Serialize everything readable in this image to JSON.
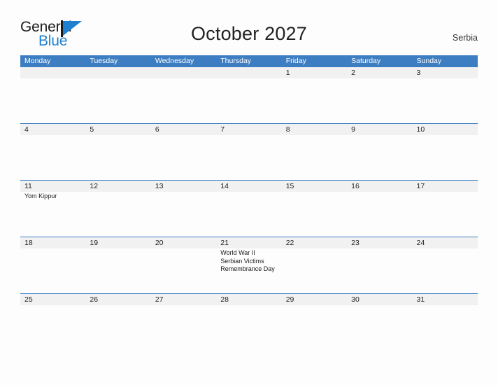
{
  "brand": {
    "name_part1": "General",
    "name_part2": "Blue",
    "flag_icon": "flag-triangle-icon"
  },
  "header": {
    "title": "October 2027",
    "region": "Serbia"
  },
  "calendar": {
    "month": "October",
    "year": "2027",
    "weekday_headers": [
      "Monday",
      "Tuesday",
      "Wednesday",
      "Thursday",
      "Friday",
      "Saturday",
      "Sunday"
    ],
    "weeks": [
      {
        "days": [
          {
            "num": "",
            "events": []
          },
          {
            "num": "",
            "events": []
          },
          {
            "num": "",
            "events": []
          },
          {
            "num": "",
            "events": []
          },
          {
            "num": "1",
            "events": []
          },
          {
            "num": "2",
            "events": []
          },
          {
            "num": "3",
            "events": []
          }
        ]
      },
      {
        "days": [
          {
            "num": "4",
            "events": []
          },
          {
            "num": "5",
            "events": []
          },
          {
            "num": "6",
            "events": []
          },
          {
            "num": "7",
            "events": []
          },
          {
            "num": "8",
            "events": []
          },
          {
            "num": "9",
            "events": []
          },
          {
            "num": "10",
            "events": []
          }
        ]
      },
      {
        "days": [
          {
            "num": "11",
            "events": [
              "Yom Kippur"
            ]
          },
          {
            "num": "12",
            "events": []
          },
          {
            "num": "13",
            "events": []
          },
          {
            "num": "14",
            "events": []
          },
          {
            "num": "15",
            "events": []
          },
          {
            "num": "16",
            "events": []
          },
          {
            "num": "17",
            "events": []
          }
        ]
      },
      {
        "days": [
          {
            "num": "18",
            "events": []
          },
          {
            "num": "19",
            "events": []
          },
          {
            "num": "20",
            "events": []
          },
          {
            "num": "21",
            "events": [
              "World War II",
              "Serbian Victims",
              "Remembrance Day"
            ]
          },
          {
            "num": "22",
            "events": []
          },
          {
            "num": "23",
            "events": []
          },
          {
            "num": "24",
            "events": []
          }
        ]
      },
      {
        "days": [
          {
            "num": "25",
            "events": []
          },
          {
            "num": "26",
            "events": []
          },
          {
            "num": "27",
            "events": []
          },
          {
            "num": "28",
            "events": []
          },
          {
            "num": "29",
            "events": []
          },
          {
            "num": "30",
            "events": []
          },
          {
            "num": "31",
            "events": []
          }
        ]
      }
    ]
  },
  "colors": {
    "header_blue": "#3d7ec2",
    "brand_blue": "#1f7fd0",
    "day_band_gray": "#f1f1f1",
    "page_background": "#fdfdfd"
  }
}
